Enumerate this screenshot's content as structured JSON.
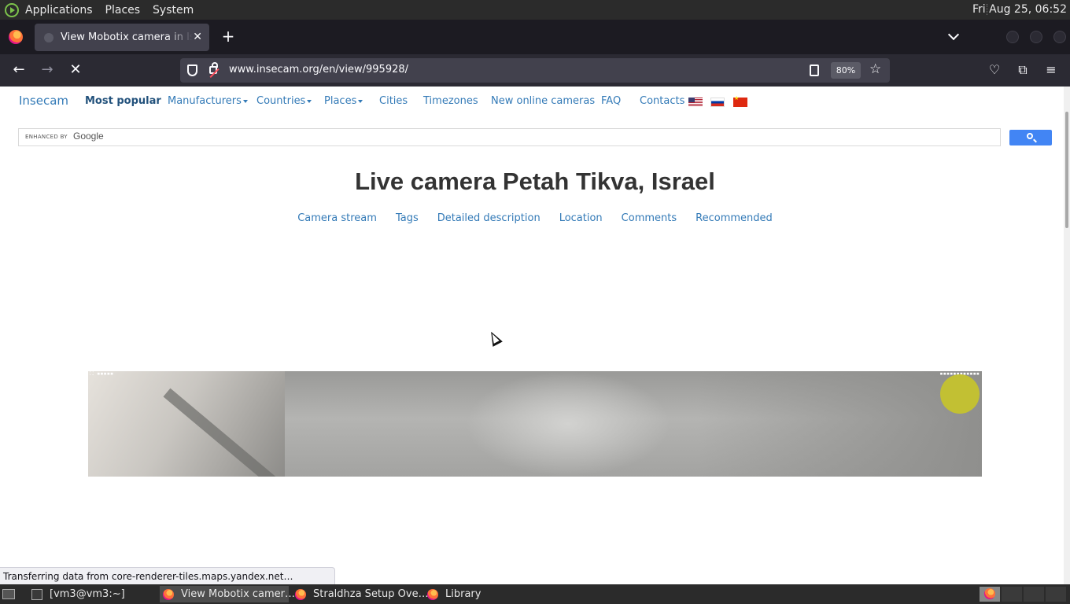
{
  "top_panel": {
    "menus": [
      "Applications",
      "Places",
      "System"
    ],
    "clock": "Fri Aug 25, 06:52"
  },
  "browser": {
    "tab_title": "View Mobotix camera in Israel",
    "url": "www.insecam.org/en/view/995928/",
    "zoom": "80%"
  },
  "site": {
    "brand": "Insecam",
    "nav": {
      "most_popular": "Most popular",
      "manufacturers": "Manufacturers",
      "countries": "Countries",
      "places": "Places",
      "cities": "Cities",
      "timezones": "Timezones",
      "new_cameras": "New online cameras",
      "faq": "FAQ",
      "contacts": "Contacts"
    },
    "search": {
      "enhanced_by": "ENHANCED BY",
      "google": "Google"
    },
    "title": "Live camera Petah Tikva, Israel",
    "anchors": [
      "Camera stream",
      "Tags",
      "Detailed description",
      "Location",
      "Comments",
      "Recommended"
    ]
  },
  "status_text": "Transferring data from core-renderer-tiles.maps.yandex.net…",
  "taskbar": {
    "tasks": [
      "[vm3@vm3:~]",
      "View Mobotix camer…",
      "Straldhza Setup Ove…",
      "Library"
    ]
  },
  "colors": {
    "link": "#337ab7",
    "panel": "#2b2b2b",
    "firefox_chrome": "#1c1b22"
  },
  "icons": [
    "gnome-foot-icon",
    "firefox-icon",
    "shield-icon",
    "lock-insecure-icon",
    "reader-view-icon",
    "bookmark-star-icon",
    "pocket-icon",
    "extensions-icon",
    "hamburger-menu-icon"
  ]
}
